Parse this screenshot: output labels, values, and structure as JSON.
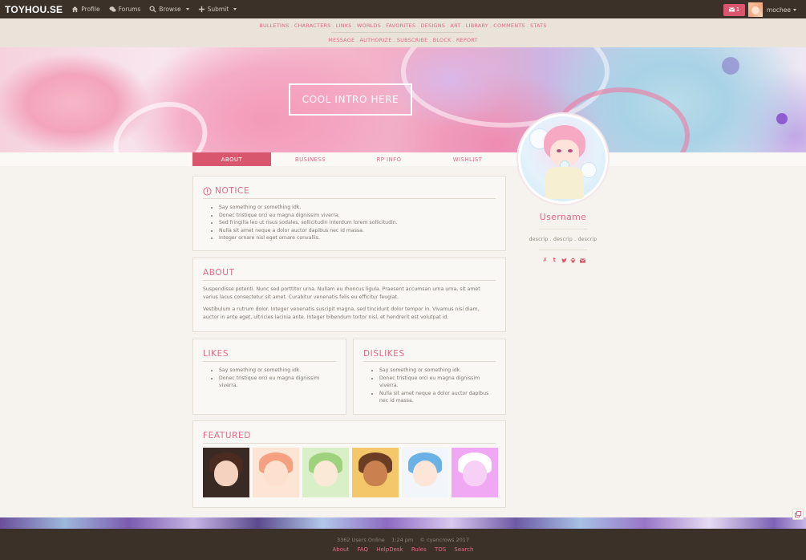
{
  "topnav": {
    "brand": "TOYHOU.SE",
    "items": [
      {
        "label": "Profile",
        "icon": "home-icon"
      },
      {
        "label": "Forums",
        "icon": "chat-icon"
      },
      {
        "label": "Browse",
        "icon": "search-icon"
      },
      {
        "label": "Submit",
        "icon": "plus-icon"
      }
    ],
    "mail_count": "1",
    "username": "mochee"
  },
  "subnav": {
    "row1": [
      "BULLETINS",
      "CHARACTERS",
      "LINKS",
      "WORLDS",
      "FAVORITES",
      "DESIGNS",
      "ART",
      "LIBRARY",
      "COMMENTS",
      "STATS"
    ],
    "row2": [
      "MESSAGE",
      "AUTHORIZE",
      "SUBSCRIBE",
      "BLOCK",
      "REPORT"
    ]
  },
  "banner": {
    "intro_text": "COOL INTRO HERE"
  },
  "tabs": [
    {
      "label": "ABOUT",
      "active": true
    },
    {
      "label": "BUSINESS",
      "active": false
    },
    {
      "label": "RP INFO",
      "active": false
    },
    {
      "label": "WISHLIST",
      "active": false
    }
  ],
  "notice": {
    "title": "NOTICE",
    "items": [
      "Say something or something idk.",
      "Donec tristique orci eu magna dignissim viverra.",
      "Sed fringilla leo ut risus sodales, sollicitudin interdum lorem sollicitudin.",
      "Nulla sit amet neque a dolor auctor dapibus nec id massa.",
      "Integer ornare nisl eget ornare convallis."
    ]
  },
  "about": {
    "title": "ABOUT",
    "paragraphs": [
      "Suspendisse potenti. Nunc sed porttitor urna. Nullam eu rhoncus ligula. Praesent accumsan urna urna, sit amet varius lacus consectetur sit amet. Curabitur venenatis felis eu efficitur feugiat.",
      "Vestibulum a rutrum dolor. Integer venenatis suscipit magna, sed tincidunt dolor tempor in. Vivamus nisi diam, auctor in ante eget, ultricies lacinia ante. Integer bibendum tortor nisl, et hendrerit est volutpat id."
    ]
  },
  "likes": {
    "title": "LIKES",
    "items": [
      "Say something or something idk.",
      "Donec tristique orci eu magna dignissim viverra."
    ]
  },
  "dislikes": {
    "title": "DISLIKES",
    "items": [
      "Say something or something idk.",
      "Donec tristique orci eu magna dignissim viverra.",
      "Nulla sit amet neque a dolor auctor dapibus nec id massa."
    ]
  },
  "featured": {
    "title": "FEATURED",
    "thumbs": [
      {
        "name": "featured-character-1",
        "bg": "#3a2a24",
        "hair": "#4b2a1f",
        "skin": "#f4d2bf"
      },
      {
        "name": "featured-character-2",
        "bg": "#fde5d6",
        "hair": "#f6a082",
        "skin": "#fde0cf"
      },
      {
        "name": "featured-character-3",
        "bg": "#d8efc7",
        "hair": "#9fd27c",
        "skin": "#fbe9d8"
      },
      {
        "name": "featured-character-4",
        "bg": "#f4c76b",
        "hair": "#6a3d24",
        "skin": "#c9824f"
      },
      {
        "name": "featured-character-5",
        "bg": "#f2f6fb",
        "hair": "#6ab1e6",
        "skin": "#fde6d7"
      },
      {
        "name": "featured-character-6",
        "bg": "#f0a8f4",
        "hair": "#ffffff",
        "skin": "#f7d1f5"
      }
    ]
  },
  "profile": {
    "name": "Username",
    "descrip": "descrip . descrip . descrip",
    "social_icons": [
      "deviantart-icon",
      "tumblr-icon",
      "twitter-icon",
      "paw-icon",
      "mail-icon"
    ]
  },
  "footer": {
    "users_online": "3362 Users Online",
    "time": "1:24 pm",
    "copyright": "© cyancrows 2017",
    "links": [
      "About",
      "FAQ",
      "HelpDesk",
      "Rules",
      "TOS",
      "Search"
    ]
  },
  "colors": {
    "accent": "#e16a86",
    "active_tab": "#d9566f",
    "topbar": "#3b3129",
    "page_bg": "#f6f3ee"
  }
}
